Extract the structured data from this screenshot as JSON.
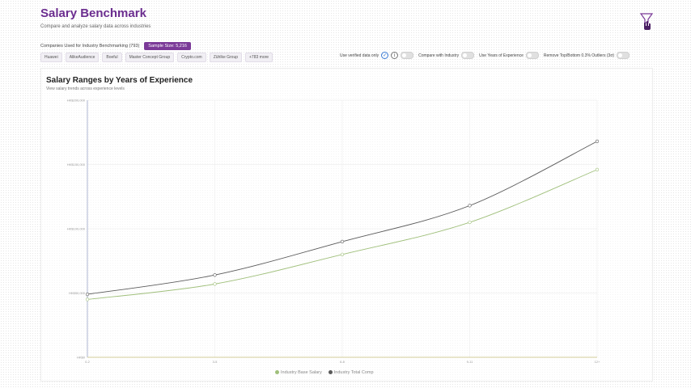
{
  "header": {
    "title": "Salary Benchmark",
    "subtitle": "Compare and analyze salary data across industries"
  },
  "companies": {
    "label": "Companies Used for Industry Benchmarking (793)",
    "sample_badge": "Sample Size: 5,216",
    "chips": [
      "Huawei",
      "AlikeAudience",
      "Boeful",
      "Master Concept Group",
      "Crypto.com",
      "Zühlke Group",
      "+783 more"
    ]
  },
  "toggles": {
    "verified": "Use verified data only",
    "compare": "Compare with Industry",
    "years": "Use Years of Experience",
    "outliers": "Remove Top/Bottom 0.3% Outliers (3σ)",
    "check_glyph": "✓",
    "info_glyph": "i"
  },
  "chart": {
    "title": "Salary Ranges by Years of Experience",
    "subtitle": "View salary trends across experience levels"
  },
  "chart_data": {
    "type": "line",
    "categories": [
      "0-2",
      "3-5",
      "6-8",
      "9-11",
      "12+"
    ],
    "ylim": [
      0,
      200000
    ],
    "yticks": [
      0,
      50000,
      100000,
      150000,
      200000
    ],
    "ytick_labels": [
      "HK$0",
      "HK$50,000",
      "HK$100,000",
      "HK$150,000",
      "HK$200,000"
    ],
    "series": [
      {
        "name": "Industry Base Salary",
        "color": "#9fbf7a",
        "values": [
          45000,
          57000,
          80000,
          105000,
          146000
        ]
      },
      {
        "name": "Industry Total Comp",
        "color": "#5a5a5a",
        "values": [
          49000,
          64000,
          90000,
          118000,
          168000
        ]
      }
    ],
    "grid": true,
    "legend_position": "bottom"
  },
  "icons": {
    "user_filter": "filter-hand-icon"
  }
}
